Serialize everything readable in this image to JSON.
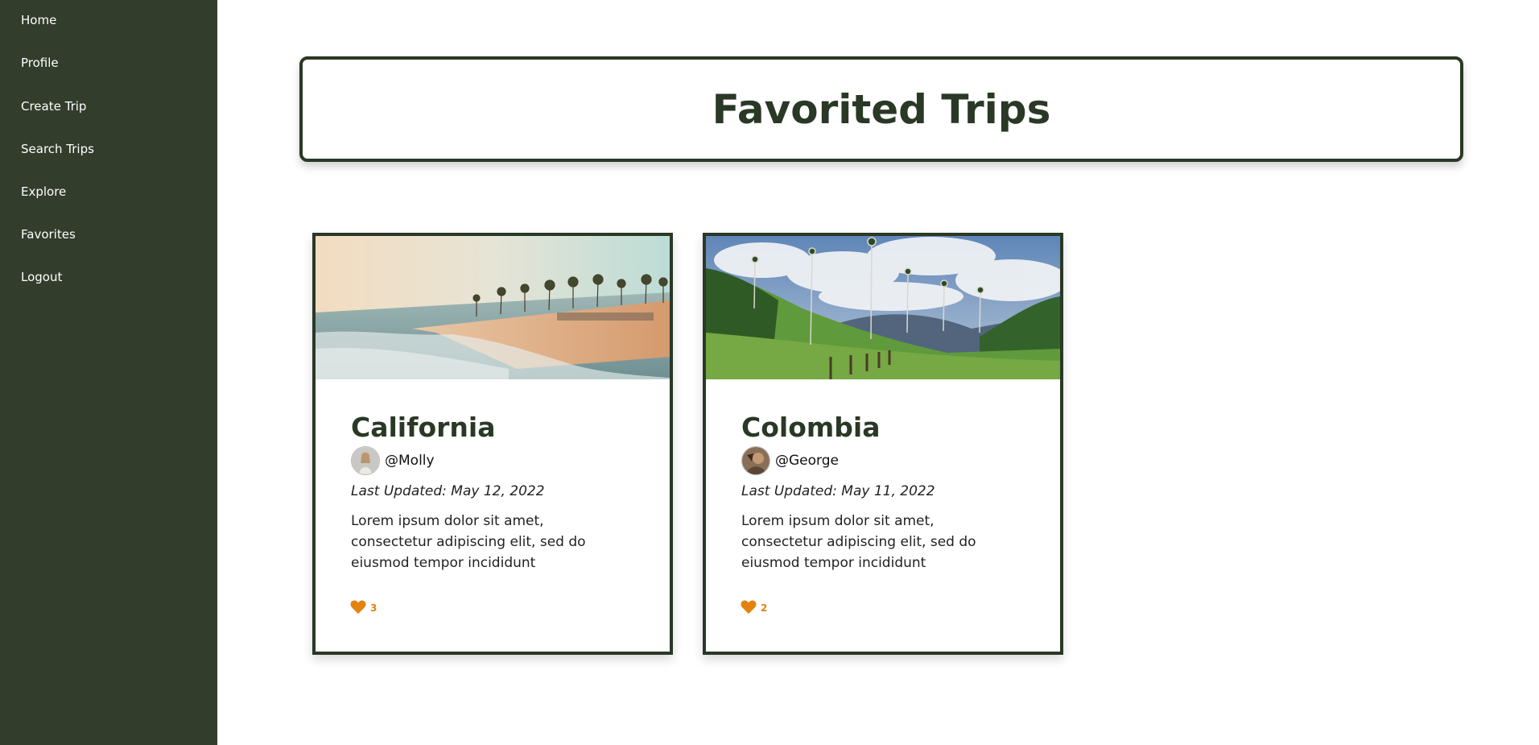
{
  "sidebar": {
    "items": [
      {
        "label": "Home"
      },
      {
        "label": "Profile"
      },
      {
        "label": "Create Trip"
      },
      {
        "label": "Search Trips"
      },
      {
        "label": "Explore"
      },
      {
        "label": "Favorites"
      },
      {
        "label": "Logout"
      }
    ]
  },
  "header": {
    "title": "Favorited Trips"
  },
  "trips": [
    {
      "title": "California",
      "author": "@Molly",
      "last_updated": "Last Updated: May 12, 2022",
      "description": "Lorem ipsum dolor sit amet, consectetur adipiscing elit, sed do eiusmod tempor incididunt",
      "likes": "3"
    },
    {
      "title": "Colombia",
      "author": "@George",
      "last_updated": "Last Updated: May 11, 2022",
      "description": "Lorem ipsum dolor sit amet, consectetur adipiscing elit, sed do eiusmod tempor incididunt",
      "likes": "2"
    }
  ],
  "colors": {
    "sidebar_bg": "#323d2c",
    "accent_dark_green": "#2a3826",
    "heart": "#e3830f"
  },
  "icons": {
    "like": "heart-icon"
  }
}
